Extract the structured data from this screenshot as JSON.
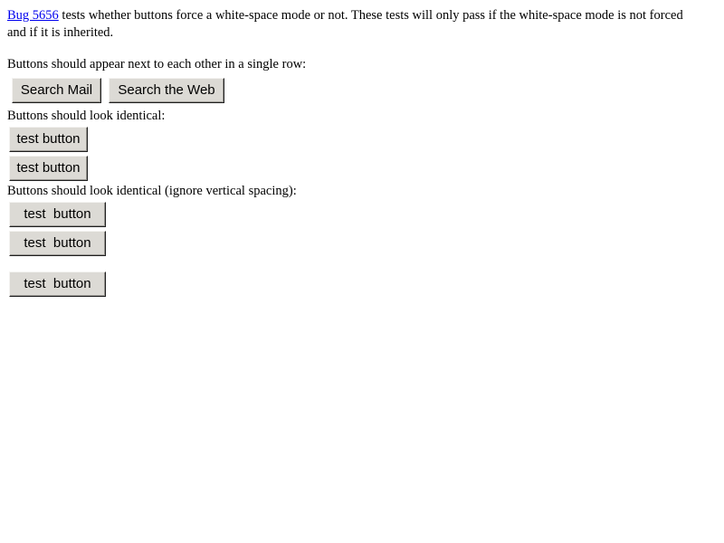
{
  "intro": {
    "link": "Bug 5656",
    "line1_rest": " tests whether buttons force a white-space mode or not. These tests will only pass if the white-space mode is not forced",
    "line2": "and if it is inherited."
  },
  "section1": {
    "label": "Buttons should appear next to each other in a single row:",
    "buttons": [
      "Search Mail",
      "Search the Web"
    ]
  },
  "section2": {
    "label": "Buttons should look identical:",
    "buttons": [
      "test button",
      "test button"
    ]
  },
  "section3": {
    "label": "Buttons should look identical (ignore vertical spacing):",
    "buttons": [
      "test  button",
      "test  button",
      "test  button"
    ]
  }
}
